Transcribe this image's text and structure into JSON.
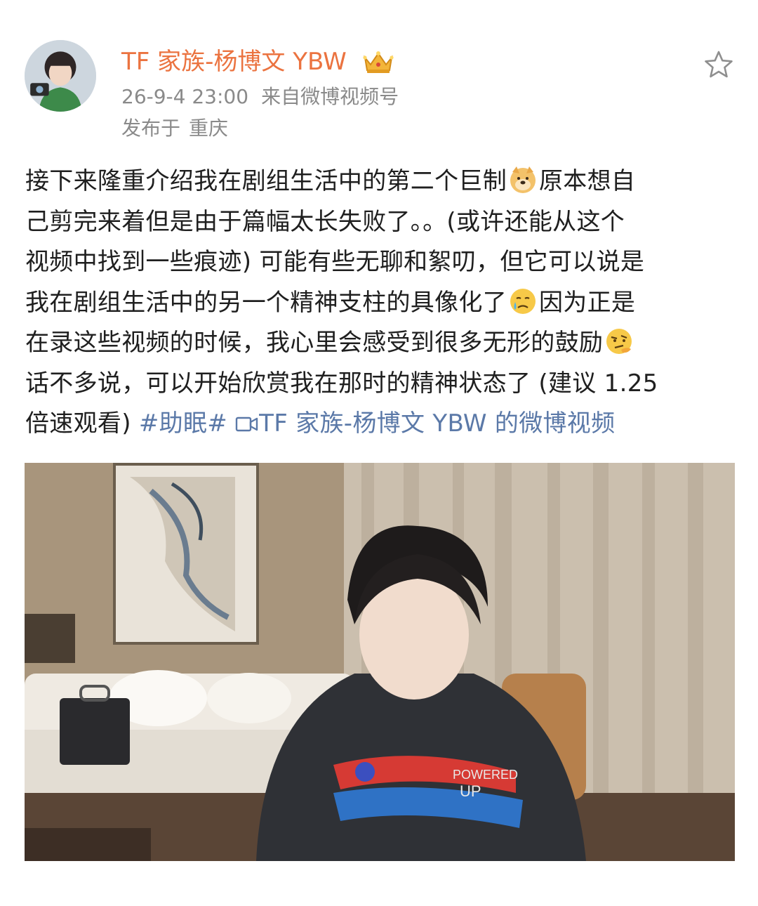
{
  "post": {
    "author": "TF 家族-杨博文 YBW",
    "time": "26-9-4 23:00",
    "source": "来自微博视频号",
    "location_label": "发布于",
    "location": "重庆",
    "text_lines": [
      "接下来隆重介绍我在剧组生活中的第二个巨制",
      "原本想自",
      "己剪完来着但是由于篇幅太长失败了。。(或许还能从这个",
      "视频中找到一些痕迹) 可能有些无聊和絮叨，但它可以说是",
      "我在剧组生活中的另一个精神支柱的具像化了",
      "因为正是",
      "在录这些视频的时候，我心里会感受到很多无形的鼓励",
      "话不多说，可以开始欣赏我在那时的精神状态了 (建议 1.25",
      "倍速观看) "
    ],
    "hashtag": "#助眠#",
    "video_link": "TF 家族-杨博文 YBW 的微博视频"
  },
  "icons": {
    "crown": "crown-badge-icon",
    "star": "star-icon",
    "video_link": "video-camera-icon",
    "emoji_1": "doge-emoji-icon",
    "emoji_2": "teary-face-emoji-icon",
    "emoji_3": "thinking-face-emoji-icon"
  },
  "colors": {
    "author": "#eb7340",
    "link": "#5b79a8",
    "meta": "#8a8a8a"
  }
}
